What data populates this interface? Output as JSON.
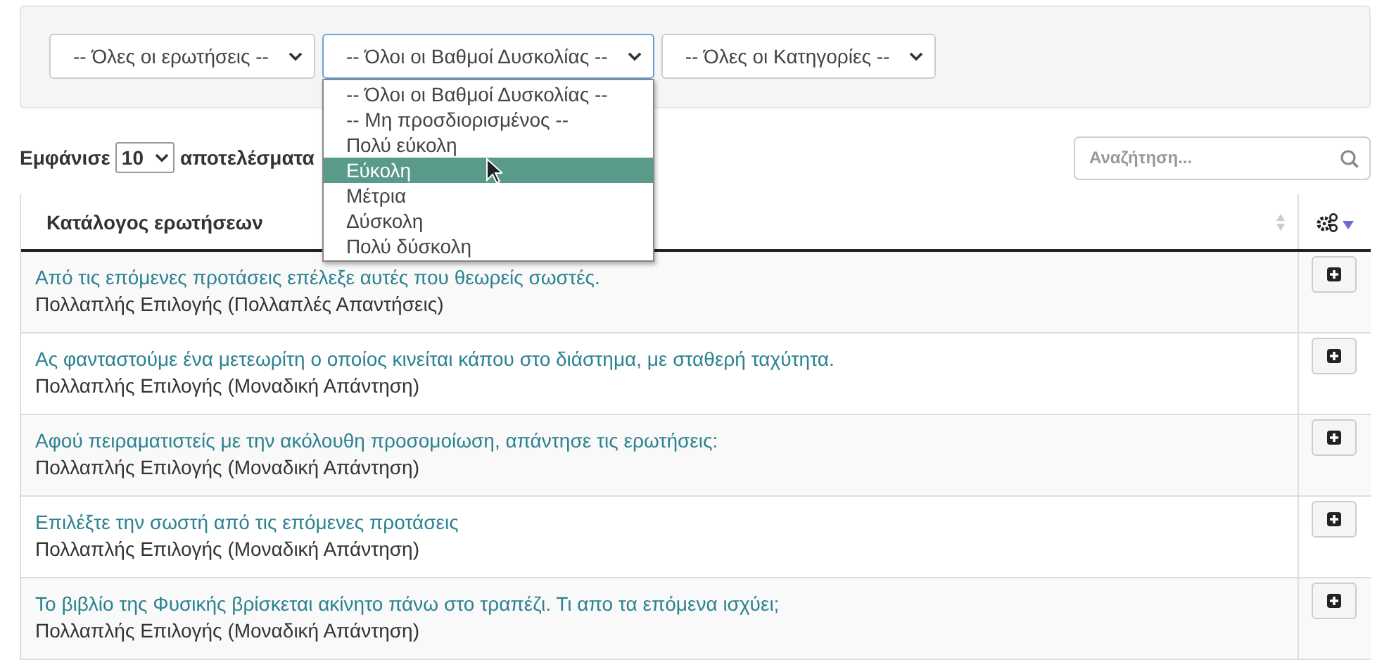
{
  "filters": [
    {
      "value": "-- Όλες οι ερωτήσεις --",
      "open": false
    },
    {
      "value": "-- Όλοι οι Βαθμοί Δυσκολίας --",
      "open": true
    },
    {
      "value": "-- Όλες οι Κατηγορίες --",
      "open": false
    }
  ],
  "dropdown": {
    "options": [
      {
        "label": "-- Όλοι οι Βαθμοί Δυσκολίας --",
        "selected": false
      },
      {
        "label": "-- Μη προσδιορισμένος --",
        "selected": false
      },
      {
        "label": "Πολύ εύκολη",
        "selected": false
      },
      {
        "label": "Εύκολη",
        "selected": true
      },
      {
        "label": "Μέτρια",
        "selected": false
      },
      {
        "label": "Δύσκολη",
        "selected": false
      },
      {
        "label": "Πολύ δύσκολη",
        "selected": false
      }
    ]
  },
  "length": {
    "before": "Εμφάνισε",
    "value": "10",
    "after": "αποτελέσματα"
  },
  "search": {
    "placeholder": "Αναζήτηση..."
  },
  "table": {
    "columns": [
      "Κατάλογος ερωτήσεων"
    ],
    "rows": [
      {
        "question": "Από τις επόμενες προτάσεις επέλεξε αυτές που θεωρείς σωστές.",
        "type": "Πολλαπλής Επιλογής (Πολλαπλές Απαντήσεις)"
      },
      {
        "question": "Ας φανταστούμε ένα μετεωρίτη ο οποίος κινείται κάπου στο διάστημα, με σταθερή ταχύτητα.",
        "type": "Πολλαπλής Επιλογής (Μοναδική Απάντηση)"
      },
      {
        "question": "Αφού πειραματιστείς με την ακόλουθη προσομοίωση, απάντησε τις ερωτήσεις:",
        "type": "Πολλαπλής Επιλογής (Μοναδική Απάντηση)"
      },
      {
        "question": "Επιλέξτε την σωστή από τις επόμενες προτάσεις",
        "type": "Πολλαπλής Επιλογής (Μοναδική Απάντηση)"
      },
      {
        "question": "Το βιβλίο της Φυσικής βρίσκεται ακίνητο πάνω στο τραπέζι. Τι απο τα επόμενα ισχύει;",
        "type": "Πολλαπλής Επιλογής (Μοναδική Απάντηση)"
      }
    ]
  }
}
